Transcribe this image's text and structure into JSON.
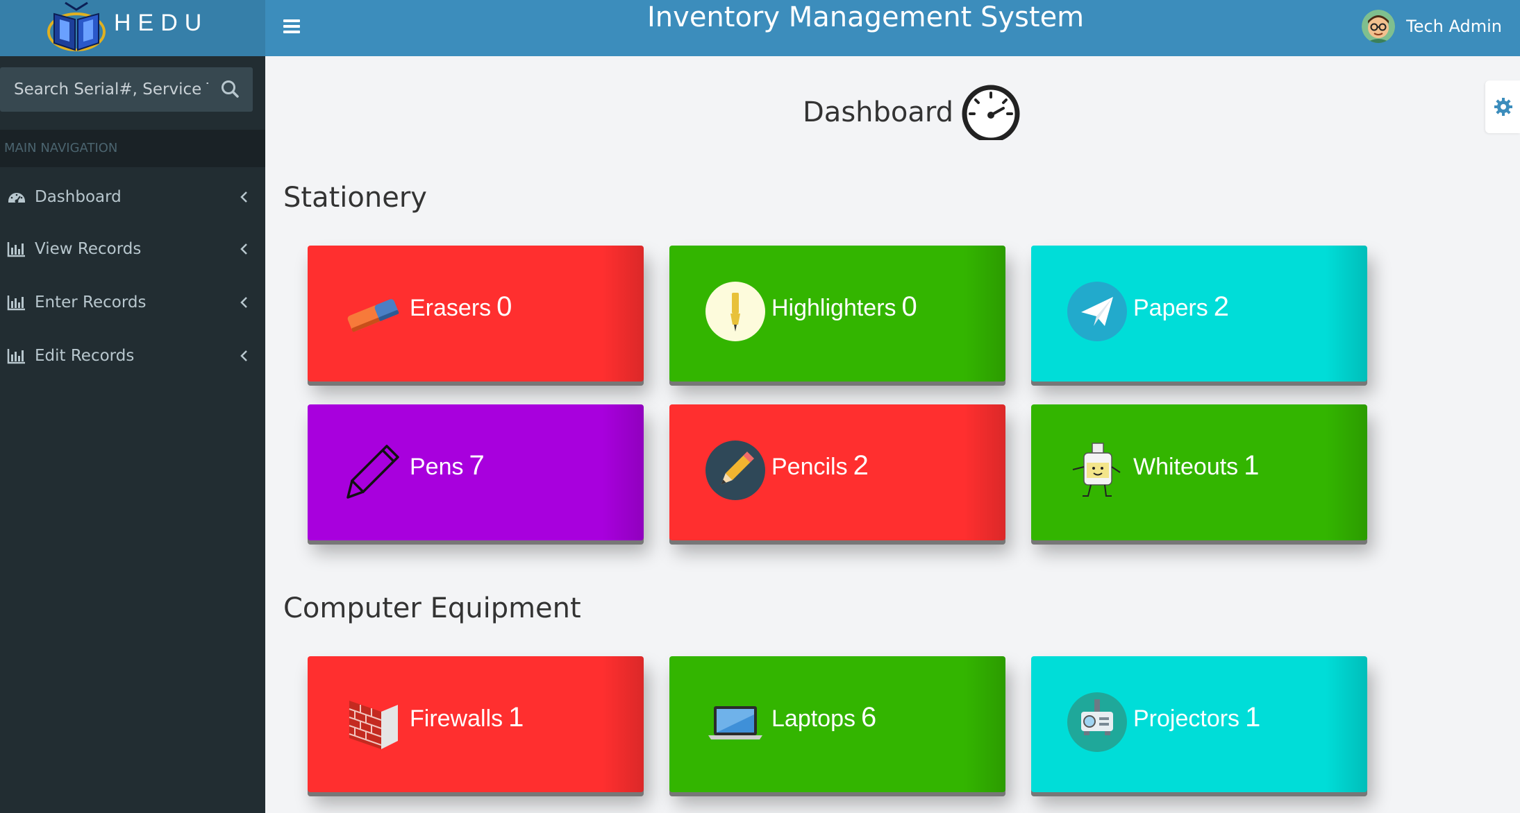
{
  "brand": {
    "name": "HEDU"
  },
  "header": {
    "title": "Inventory Management System",
    "user_name": "Tech Admin"
  },
  "sidebar": {
    "search_placeholder": "Search Serial#, Service Tag",
    "nav_header": "MAIN NAVIGATION",
    "items": [
      {
        "label": "Dashboard",
        "icon": "dashboard-icon"
      },
      {
        "label": "View Records",
        "icon": "bar-chart-icon"
      },
      {
        "label": "Enter Records",
        "icon": "bar-chart-icon"
      },
      {
        "label": "Edit Records",
        "icon": "bar-chart-icon"
      }
    ]
  },
  "page": {
    "title": "Dashboard"
  },
  "sections": [
    {
      "title": "Stationery",
      "tiles": [
        {
          "label": "Erasers",
          "count": "0",
          "color": "#ff2f2f",
          "icon": "eraser-icon"
        },
        {
          "label": "Highlighters",
          "count": "0",
          "color": "#33b500",
          "icon": "highlighter-icon"
        },
        {
          "label": "Papers",
          "count": "2",
          "color": "#00ddd8",
          "icon": "paper-plane-icon"
        },
        {
          "label": "Pens",
          "count": "7",
          "color": "#a800dd",
          "icon": "pen-icon"
        },
        {
          "label": "Pencils",
          "count": "2",
          "color": "#ff2f2f",
          "icon": "pencil-icon"
        },
        {
          "label": "Whiteouts",
          "count": "1",
          "color": "#33b500",
          "icon": "whiteout-icon"
        }
      ]
    },
    {
      "title": "Computer Equipment",
      "tiles": [
        {
          "label": "Firewalls",
          "count": "1",
          "color": "#ff2f2f",
          "icon": "firewall-icon"
        },
        {
          "label": "Laptops",
          "count": "6",
          "color": "#33b500",
          "icon": "laptop-icon"
        },
        {
          "label": "Projectors",
          "count": "1",
          "color": "#00ddd8",
          "icon": "projector-icon"
        }
      ]
    }
  ]
}
